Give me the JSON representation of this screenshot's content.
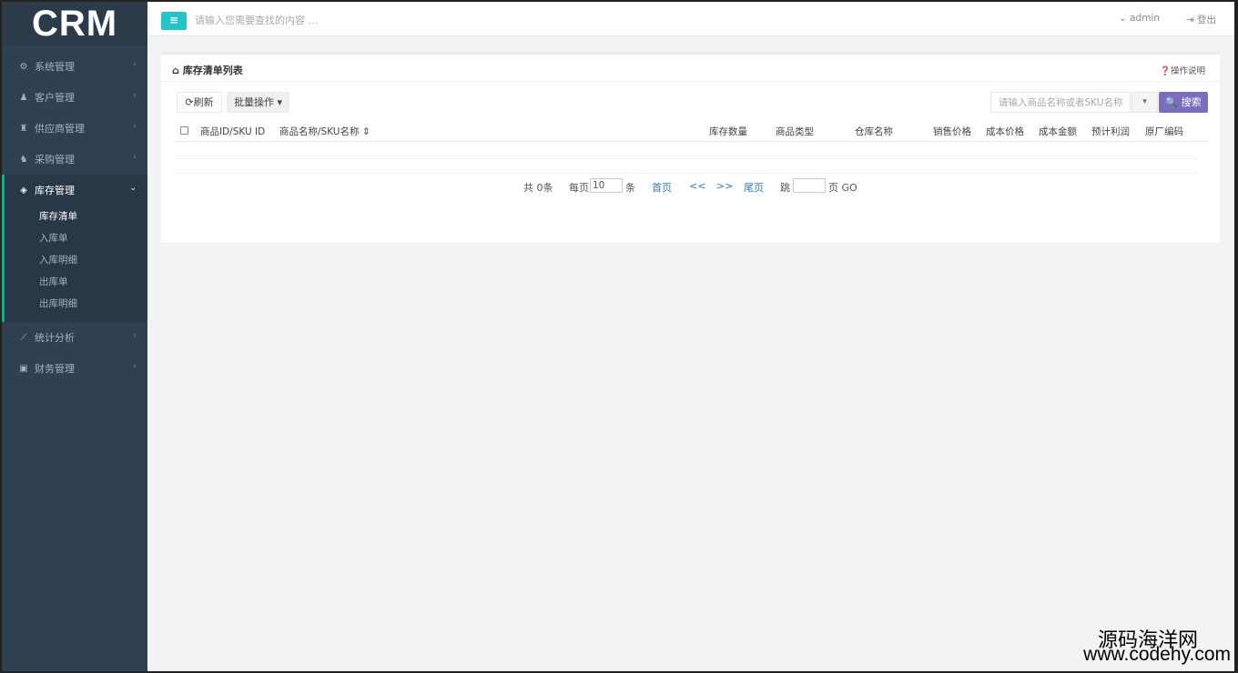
{
  "sidebar": {
    "logo": "CRM",
    "items": [
      {
        "label": "系统管理",
        "icon": "cog-icon",
        "glyph": "⚙",
        "arrow": "‹"
      },
      {
        "label": "客户管理",
        "icon": "user-icon",
        "glyph": "♟",
        "arrow": "‹"
      },
      {
        "label": "供应商管理",
        "icon": "group-icon",
        "glyph": "♜",
        "arrow": "‹"
      },
      {
        "label": "采购管理",
        "icon": "users-icon",
        "glyph": "♞",
        "arrow": "‹"
      }
    ],
    "active_group": {
      "label": "库存管理",
      "icon": "cube-icon",
      "glyph": "◈",
      "arrow": "⌄",
      "children": [
        "库存清单",
        "入库单",
        "入库明细",
        "出库单",
        "出库明细"
      ]
    },
    "items_after": [
      {
        "label": "统计分析",
        "icon": "line-chart-icon",
        "glyph": "⟋",
        "arrow": "‹"
      },
      {
        "label": "财务管理",
        "icon": "money-icon",
        "glyph": "▣",
        "arrow": "‹"
      }
    ]
  },
  "topbar": {
    "menu_glyph": "≡",
    "search_placeholder": "请输入您需要查找的内容 …",
    "user": "⌄ admin",
    "logout": "⇥ 登出"
  },
  "panel": {
    "title": "⌂ 库存清单列表",
    "help": "❓操作说明",
    "refresh": "⟳刷新",
    "batch": "批量操作 ▾",
    "search_placeholder": "请输入商品名称或者SKU名称",
    "dropdown_glyph": "▾",
    "search_button": "🔍 搜索",
    "columns": [
      "商品ID/SKU ID",
      "商品名称/SKU名称 ⇕",
      "库存数量",
      "商品类型",
      "仓库名称",
      "销售价格",
      "成本价格",
      "成本金额",
      "预计利润",
      "原厂编码"
    ]
  },
  "pager": {
    "total": "共 0条",
    "per_page_label": "每页",
    "per_page_value": "10",
    "per_page_unit": "条",
    "first": "首页",
    "prev": "<<",
    "next": ">>",
    "last": "尾页",
    "jump_label": "跳",
    "jump_value": "",
    "page_unit": "页 GO"
  },
  "watermark": {
    "cn": "源码海洋网",
    "url": "www.codehy.com"
  }
}
